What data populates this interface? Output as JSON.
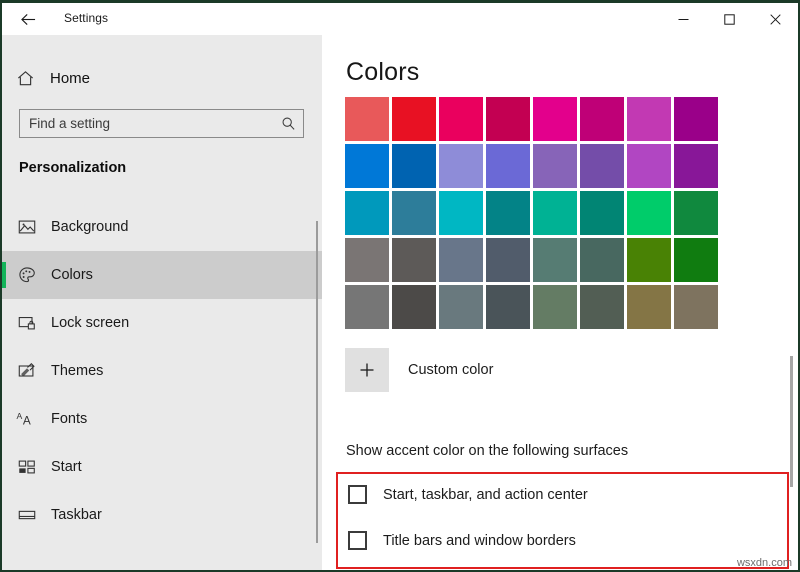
{
  "window": {
    "titlebar_title": "Settings",
    "back_icon": "back-arrow-icon",
    "minimize_label": "—",
    "maximize_label": "☐",
    "close_label": "✕"
  },
  "sidebar": {
    "home_label": "Home",
    "home_icon": "home-icon",
    "search": {
      "placeholder": "Find a setting",
      "value": "",
      "icon": "search-icon"
    },
    "category_title": "Personalization",
    "items": [
      {
        "label": "Background",
        "icon": "image-icon",
        "selected": false
      },
      {
        "label": "Colors",
        "icon": "palette-icon",
        "selected": true
      },
      {
        "label": "Lock screen",
        "icon": "lock-screen-icon",
        "selected": false
      },
      {
        "label": "Themes",
        "icon": "themes-pen-icon",
        "selected": false
      },
      {
        "label": "Fonts",
        "icon": "fonts-aa-icon",
        "selected": false
      },
      {
        "label": "Start",
        "icon": "start-tiles-icon",
        "selected": false
      },
      {
        "label": "Taskbar",
        "icon": "taskbar-icon",
        "selected": false
      }
    ]
  },
  "main": {
    "page_title": "Colors",
    "color_grid": {
      "columns": 8,
      "rows": 5,
      "swatches": [
        "#e8595a",
        "#e81123",
        "#ea005e",
        "#c30052",
        "#e3008c",
        "#bf0077",
        "#c239b3",
        "#9a0089",
        "#0078d7",
        "#0063b1",
        "#8e8cd8",
        "#6b69d6",
        "#8764b8",
        "#744da9",
        "#b146c2",
        "#881798",
        "#0099bc",
        "#2d7d9a",
        "#00b7c3",
        "#038387",
        "#00b294",
        "#018574",
        "#00cc6a",
        "#10893e",
        "#7a7574",
        "#5d5a58",
        "#68768a",
        "#515c6b",
        "#567c73",
        "#486860",
        "#498205",
        "#107c10",
        "#767676",
        "#4c4a48",
        "#69797e",
        "#4a5459",
        "#647c64",
        "#525e54",
        "#847545",
        "#7e735f"
      ]
    },
    "custom_color": {
      "label": "Custom color",
      "icon": "plus-icon"
    },
    "surfaces_heading": "Show accent color on the following surfaces",
    "checkboxes": [
      {
        "label": "Start, taskbar, and action center",
        "checked": false
      },
      {
        "label": "Title bars and window borders",
        "checked": false
      }
    ]
  },
  "watermark": "wsxdn.com",
  "colors": {
    "accent_green": "#13b45a",
    "annotation_red": "#e02020",
    "sidebar_bg": "#eaeaea",
    "selected_bg": "#cccccc"
  }
}
